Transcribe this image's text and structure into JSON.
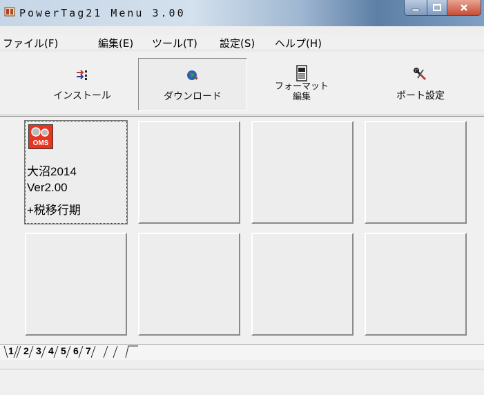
{
  "window": {
    "title": "PowerTag21 Menu 3.00"
  },
  "menu": {
    "file": "ファイル(F)",
    "edit": "編集(E)",
    "tool": "ツール(T)",
    "settings": "設定(S)",
    "help": "ヘルプ(H)"
  },
  "toolbar": {
    "install": "インストール",
    "download": "ダウンロード",
    "format_line1": "フォーマット",
    "format_line2": "編集",
    "port": "ポート設定"
  },
  "grid": {
    "cell1": {
      "badge": "OMS",
      "line1": "大沼2014",
      "line2": "Ver2.00",
      "line3": "+税移行期"
    }
  },
  "tabs": [
    "1",
    "2",
    "3",
    "4",
    "5",
    "6",
    "7"
  ],
  "colors": {
    "badge_red": "#e8351f",
    "close_red": "#c74c33"
  }
}
